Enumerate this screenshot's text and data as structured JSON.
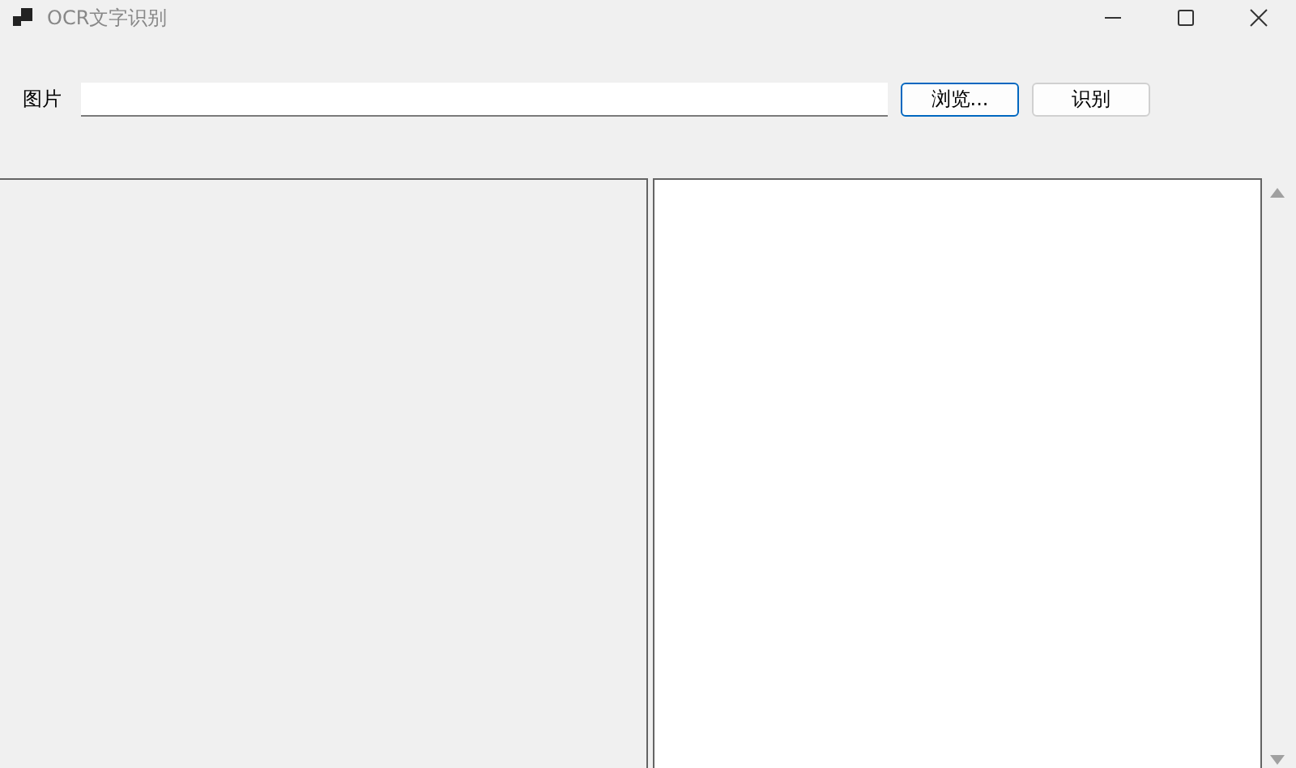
{
  "window": {
    "title": "OCR文字识别"
  },
  "form": {
    "label": "图片",
    "buttons": [
      {
        "label": "浏览...",
        "focused": true
      },
      {
        "label": "识别",
        "focused": false
      }
    ]
  }
}
